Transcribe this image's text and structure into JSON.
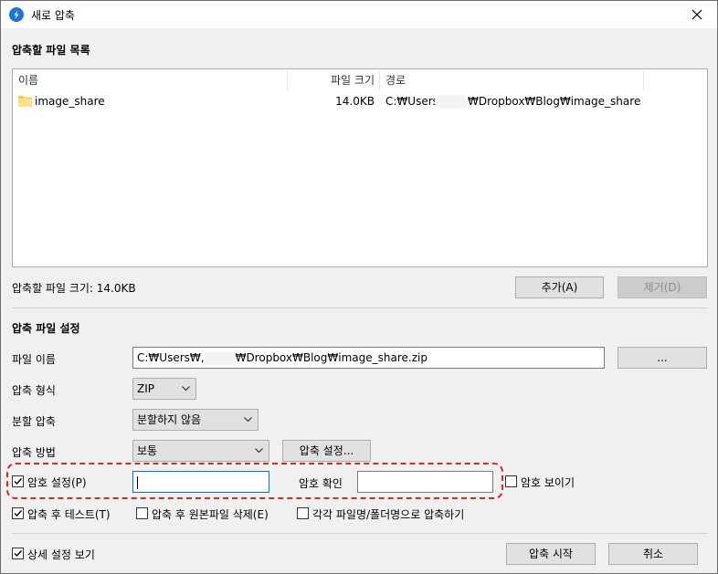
{
  "window": {
    "title": "새로 압축",
    "icon": "zip-app-icon",
    "accent": "#0078d7"
  },
  "file_list": {
    "section_title": "압축할 파일 목록",
    "columns": [
      "이름",
      "파일 크기",
      "경로"
    ],
    "rows": [
      {
        "name": "image_share",
        "size": "14.0KB",
        "path_prefix": "C:₩Users₩",
        "path_suffix": "₩Dropbox₩Blog₩image_share"
      }
    ],
    "total_size": "압축할 파일 크기: 14.0KB",
    "add_label": "추가(A)",
    "remove_label": "제거(D)"
  },
  "settings": {
    "section_title": "압축 파일 설정",
    "filename_label": "파일 이름",
    "filename_prefix": "C:₩Users₩,",
    "filename_suffix": "₩Dropbox₩Blog₩image_share.zip",
    "browse_label": "...",
    "format_label": "압축 형식",
    "format_value": "ZIP",
    "split_label": "분할 압축",
    "split_value": "분할하지 않음",
    "method_label": "압축 방법",
    "method_value": "보통",
    "method_settings_label": "압축 설정...",
    "password_label": "암호 설정(P)",
    "password_checked": true,
    "password_value": "",
    "confirm_label": "암호 확인",
    "confirm_value": "",
    "show_password_label": "암호 보이기",
    "test_label": "압축 후 테스트(T)",
    "delete_label": "압축 후 원본파일 삭제(E)",
    "separate_label": "각각 파일명/폴더명으로 압축하기"
  },
  "footer": {
    "details_label": "상세 설정 보기",
    "start_label": "압축 시작",
    "cancel_label": "취소"
  },
  "highlight_color": "#d42a2a"
}
